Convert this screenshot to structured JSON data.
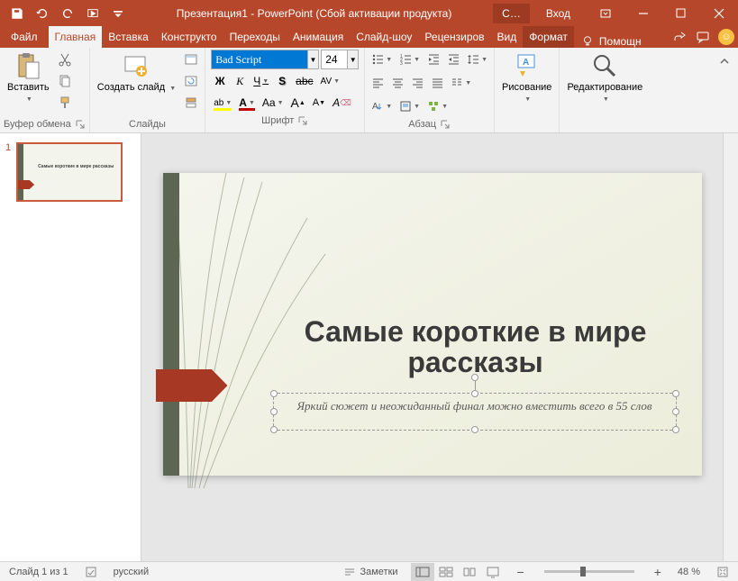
{
  "titlebar": {
    "title": "Презентация1 - PowerPoint (Сбой активации продукта)",
    "right_tab": "С…",
    "signin": "Вход"
  },
  "tabs": {
    "file": "Файл",
    "home": "Главная",
    "insert": "Вставка",
    "design": "Конструкто",
    "transitions": "Переходы",
    "animation": "Анимация",
    "slideshow": "Слайд-шоу",
    "review": "Рецензиров",
    "view": "Вид",
    "format": "Формат",
    "help": "Помощн"
  },
  "ribbon": {
    "clipboard": {
      "paste": "Вставить",
      "label": "Буфер обмена"
    },
    "slides": {
      "new_slide": "Создать слайд",
      "label": "Слайды"
    },
    "font": {
      "name": "Bad Script",
      "size": "24",
      "label": "Шрифт",
      "bold": "Ж",
      "italic": "К",
      "underline": "Ч",
      "strike": "abc",
      "shadow": "S",
      "spacing": "AV",
      "case": "Aa",
      "grow": "A",
      "shrink": "A",
      "clear": "A",
      "highlight_color": "#ffff00",
      "font_color": "#c00000"
    },
    "paragraph": {
      "label": "Абзац"
    },
    "drawing": {
      "button": "Рисование",
      "label": ""
    },
    "editing": {
      "button": "Редактирование",
      "label": ""
    }
  },
  "thumbnails": [
    {
      "num": "1",
      "title": "Самые короткие в мире рассказы"
    }
  ],
  "slide": {
    "title": "Самые короткие в мире рассказы",
    "subtitle": "Яркий сюжет и неожиданный финал можно вместить всего в 55 слов"
  },
  "statusbar": {
    "slide_info": "Слайд 1 из 1",
    "language": "русский",
    "notes": "Заметки",
    "zoom": "48 %"
  }
}
